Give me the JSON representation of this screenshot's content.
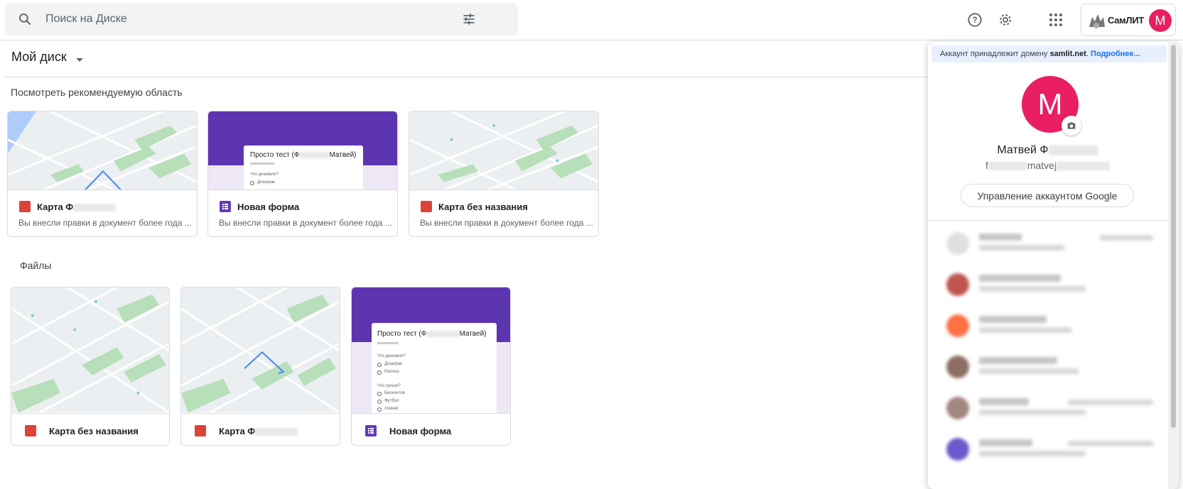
{
  "search": {
    "placeholder": "Поиск на Диске"
  },
  "header": {
    "help_icon": "help-icon",
    "settings_icon": "gear-icon",
    "apps_icon": "apps-grid-icon",
    "org_name": "СамЛИТ",
    "avatar_letter": "M"
  },
  "breadcrumb": {
    "label": "Мой диск"
  },
  "suggested": {
    "title": "Посмотреть рекомендуемую область",
    "cards": [
      {
        "type": "map",
        "name": "Карта Ф",
        "sub": "Вы внесли правки в документ более года ..."
      },
      {
        "type": "form",
        "name": "Новая форма",
        "sub": "Вы внесли правки в документ более года ...",
        "preview_title": "Просто тест (Ф",
        "preview_title_end": "Матвей)",
        "preview_q1": "Что дешевле?",
        "preview_opt1": "Дошерак"
      },
      {
        "type": "map",
        "name": "Карта без названия",
        "sub": "Вы внесли правки в документ более года ..."
      }
    ]
  },
  "files": {
    "title": "Файлы",
    "cards": [
      {
        "type": "map",
        "name": "Карта без названия"
      },
      {
        "type": "map",
        "name": "Карта Ф"
      },
      {
        "type": "form",
        "name": "Новая форма",
        "preview_title": "Просто тест (Ф",
        "preview_title_end": "Матвей)",
        "preview_q1": "Что дешевле?",
        "preview_q1_opts": [
          "Дошерак",
          "Роллон"
        ],
        "preview_q2": "Что лучше?",
        "preview_q2_opts": [
          "Бесконтов",
          "Футбол",
          "Хоккей"
        ]
      }
    ]
  },
  "account_panel": {
    "domain_text": "Аккаунт принадлежит домену ",
    "domain_name": "samlit.net",
    "domain_link": "Подробнее...",
    "avatar_letter": "M",
    "name": "Матвей Ф",
    "email_mid": "matvej",
    "email_prefix": "f",
    "manage_label": "Управление аккаунтом Google",
    "camera_icon": "camera-icon"
  },
  "colors": {
    "accent": "#1a73e8",
    "avatar": "#e91e63",
    "form_purple": "#5e35b1",
    "maps_red": "#db4437"
  }
}
